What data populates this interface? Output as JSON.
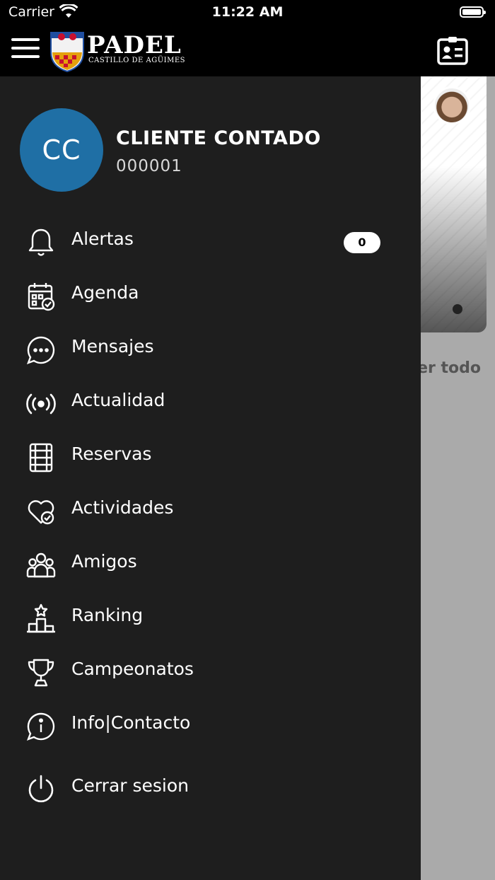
{
  "status_bar": {
    "carrier": "Carrier",
    "time": "11:22 AM"
  },
  "header": {
    "logo_title": "PADEL",
    "logo_subtitle": "CASTILLO DE AGÜIMES",
    "logo_shield_text": "Castillo de Agüimes"
  },
  "background": {
    "see_all_partial": "er todo"
  },
  "drawer": {
    "user": {
      "initials": "CC",
      "name": "CLIENTE CONTADO",
      "id": "000001"
    },
    "menu": [
      {
        "label": "Alertas",
        "icon": "bell-icon",
        "badge": "0"
      },
      {
        "label": "Agenda",
        "icon": "calendar-check-icon"
      },
      {
        "label": "Mensajes",
        "icon": "chat-bubble-icon"
      },
      {
        "label": "Actualidad",
        "icon": "broadcast-icon"
      },
      {
        "label": "Reservas",
        "icon": "court-icon"
      },
      {
        "label": "Actividades",
        "icon": "heart-check-icon"
      },
      {
        "label": "Amigos",
        "icon": "group-icon"
      },
      {
        "label": "Ranking",
        "icon": "podium-icon"
      },
      {
        "label": "Campeonatos",
        "icon": "trophy-icon"
      },
      {
        "label": "Info|Contacto",
        "icon": "info-chat-icon"
      },
      {
        "label": "Cerrar sesion",
        "icon": "power-icon"
      }
    ]
  },
  "colors": {
    "avatar": "#1f6fa5",
    "drawer_bg": "#1e1e1e",
    "header_bg": "#000000",
    "overlay": "#aaaaaa"
  }
}
